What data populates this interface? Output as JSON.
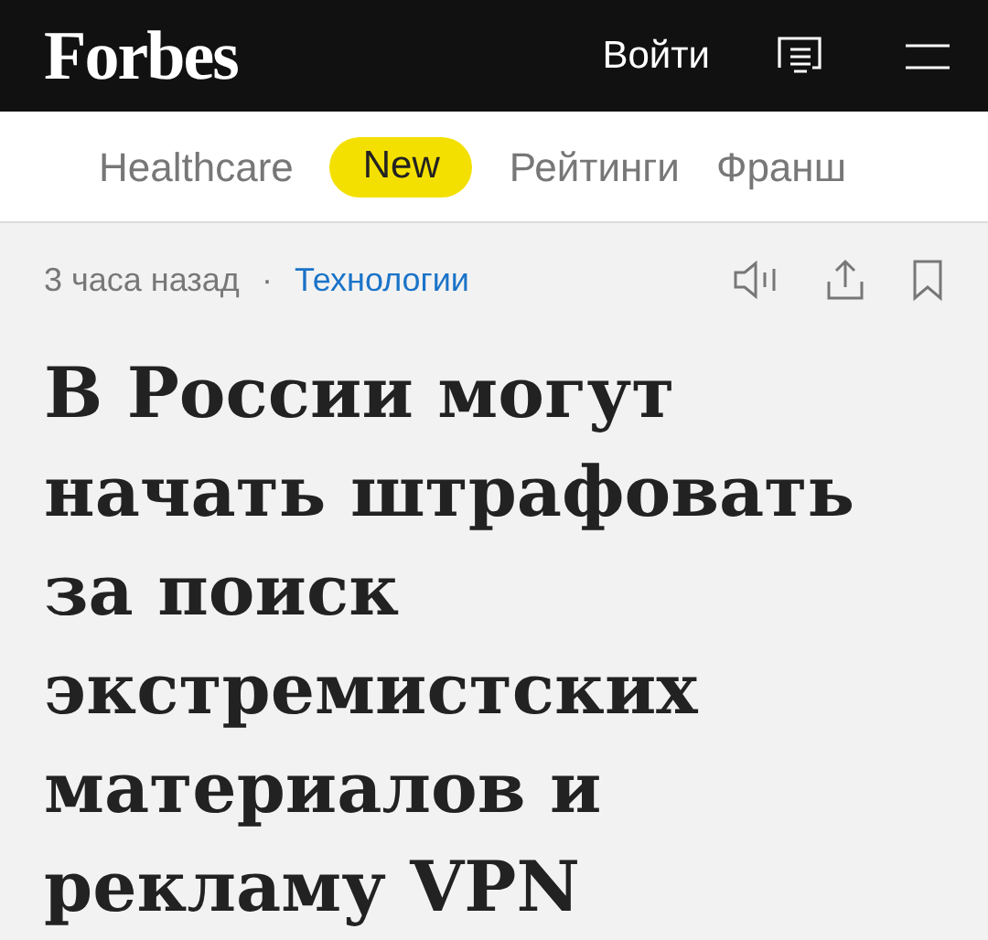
{
  "header": {
    "logo": "Forbes",
    "login": "Войти"
  },
  "nav": [
    {
      "kind": "link",
      "label": "Healthcare"
    },
    {
      "kind": "badge",
      "label": "New"
    },
    {
      "kind": "link",
      "label": "Рейтинги"
    },
    {
      "kind": "link",
      "label": "Франш"
    }
  ],
  "article": {
    "time": "3 часа назад",
    "separator": "·",
    "category": "Технологии",
    "headline": "В России могут начать штрафовать за поиск экстремистских материалов и рекламу VPN"
  }
}
